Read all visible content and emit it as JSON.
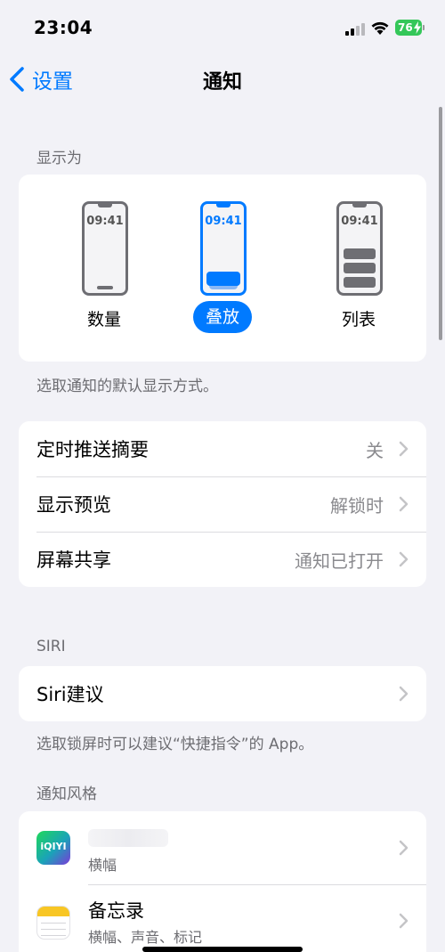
{
  "status_bar": {
    "time": "23:04",
    "battery": "76"
  },
  "nav": {
    "back_label": "设置",
    "title": "通知"
  },
  "display_as": {
    "header": "显示为",
    "options": [
      {
        "label": "数量",
        "time": "09:41",
        "selected": false
      },
      {
        "label": "叠放",
        "time": "09:41",
        "selected": true
      },
      {
        "label": "列表",
        "time": "09:41",
        "selected": false
      }
    ],
    "footer": "选取通知的默认显示方式。"
  },
  "settings": [
    {
      "title": "定时推送摘要",
      "value": "关"
    },
    {
      "title": "显示预览",
      "value": "解锁时"
    },
    {
      "title": "屏幕共享",
      "value": "通知已打开"
    }
  ],
  "siri": {
    "header": "SIRI",
    "row_title": "Siri建议",
    "footer": "选取锁屏时可以建议“快捷指令”的 App。"
  },
  "notification_style": {
    "header": "通知风格",
    "apps": [
      {
        "icon": "iqiyi-icon",
        "icon_text": "iQIYI",
        "subtitle": "横幅"
      },
      {
        "icon": "notes-icon",
        "name": "备忘录",
        "subtitle": "横幅、声音、标记"
      }
    ]
  },
  "colors": {
    "accent": "#007aff",
    "background": "#f2f2f7",
    "battery": "#34c759"
  }
}
